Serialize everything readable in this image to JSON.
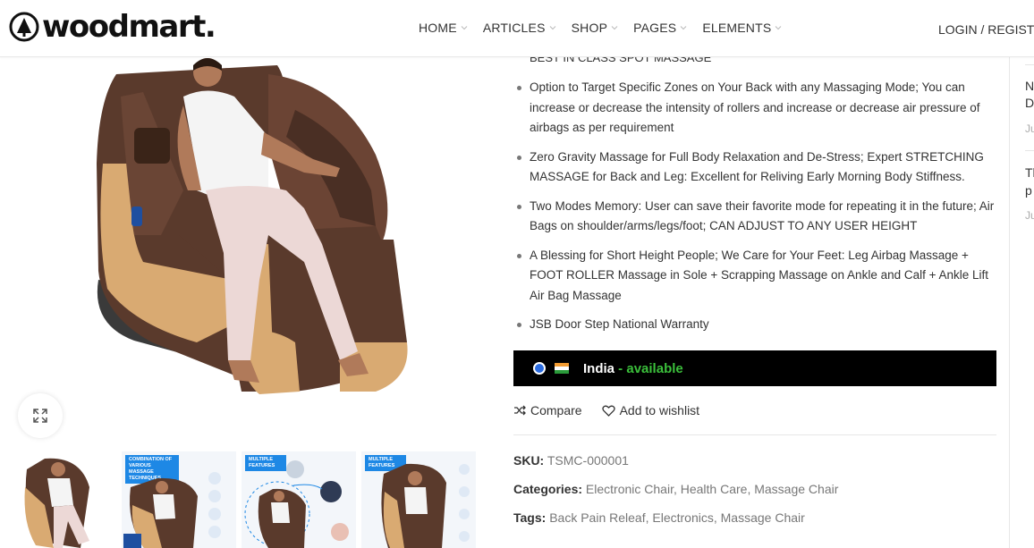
{
  "header": {
    "logo_text": "woodmart.",
    "nav": [
      {
        "label": "HOME"
      },
      {
        "label": "ARTICLES"
      },
      {
        "label": "SHOP"
      },
      {
        "label": "PAGES"
      },
      {
        "label": "ELEMENTS"
      }
    ],
    "login_label": "LOGIN / REGISTER"
  },
  "product": {
    "top_line": "BEST IN CLASS SPOT MASSAGE",
    "features": [
      "Option to Target Specific Zones on Your Back with any Massaging Mode; You can increase or decrease the intensity of rollers and increase or decrease air pressure of airbags as per requirement",
      "Zero Gravity Massage for Full Body Relaxation and De-Stress; Expert STRETCHING MASSAGE for Back and Leg: Excellent for Reliving Early Morning Body Stiffness.",
      "Two Modes Memory: User can save their favorite mode for repeating it in the future; Air Bags on shoulder/arms/legs/foot; CAN ADJUST TO ANY USER HEIGHT",
      "A Blessing for Short Height People; We Care for Your Feet: Leg Airbag Massage + FOOT ROLLER Massage in Sole + Scrapping Massage on Ankle and Calf + Ankle Lift Air Bag Massage",
      "JSB Door Step National Warranty"
    ],
    "availability": {
      "country": "India",
      "separator": " - ",
      "status": "available"
    },
    "actions": {
      "compare": "Compare",
      "wishlist": "Add to wishlist"
    },
    "sku": {
      "label": "SKU:",
      "value": "TSMC-000001"
    },
    "categories": {
      "label": "Categories:",
      "items": [
        "Electronic Chair",
        "Health Care",
        "Massage Chair"
      ]
    },
    "tags": {
      "label": "Tags:",
      "items": [
        "Back Pain Releaf",
        "Electronics",
        "Massage Chair"
      ]
    }
  },
  "thumbs": {
    "t2": {
      "line1": "COMBINATION OF",
      "line2": "VARIOUS MASSAGE",
      "line3": "TECHNIQUES"
    },
    "t3": {
      "line1": "MULTIPLE",
      "line2": "FEATURES"
    },
    "t4": {
      "line1": "MULTIPLE",
      "line2": "FEATURES"
    }
  },
  "sidebar": {
    "items": [
      {
        "line1": "N",
        "line2": "D",
        "date": "Ju"
      },
      {
        "line1": "Th",
        "line2": "p",
        "date": "Ju"
      }
    ]
  },
  "colors": {
    "chair_brown": "#5a3a2c",
    "chair_gold": "#d9aa72",
    "availability_bg": "#000000",
    "available_green": "#3bbf3b",
    "thumb_banner_blue": "#1e88e5"
  }
}
